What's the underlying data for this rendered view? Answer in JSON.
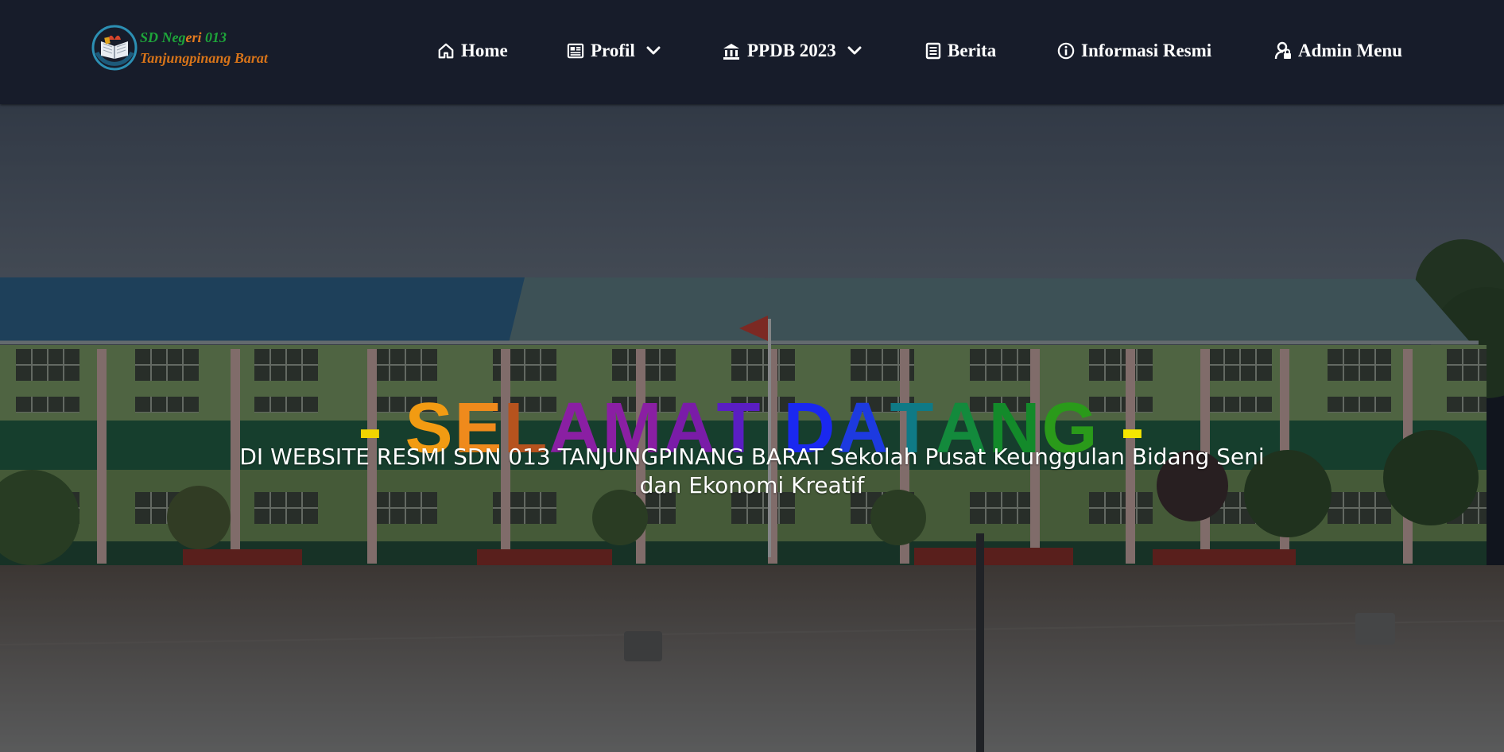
{
  "logo": {
    "line1_green_a": "SD Neg",
    "line1_orange": "eri",
    "line1_green_b": " 013",
    "line2": "Tanjungpinang Barat"
  },
  "nav": [
    {
      "label": "Home",
      "icon": "home-icon",
      "dropdown": false
    },
    {
      "label": "Profil",
      "icon": "newspaper-icon",
      "dropdown": true
    },
    {
      "label": "PPDB 2023",
      "icon": "bank-icon",
      "dropdown": true
    },
    {
      "label": "Berita",
      "icon": "document-icon",
      "dropdown": false
    },
    {
      "label": "Informasi Resmi",
      "icon": "info-circle-icon",
      "dropdown": false
    },
    {
      "label": "Admin Menu",
      "icon": "user-lock-icon",
      "dropdown": false
    }
  ],
  "hero": {
    "headline_chars": [
      {
        "c": "-",
        "color": "#f2d400"
      },
      {
        "c": " ",
        "color": "#ffffff"
      },
      {
        "c": "S",
        "color": "#f29b12"
      },
      {
        "c": "E",
        "color": "#ef8a1c"
      },
      {
        "c": "L",
        "color": "#b6531e"
      },
      {
        "c": "A",
        "color": "#8a1fa3"
      },
      {
        "c": "M",
        "color": "#8a1fa3"
      },
      {
        "c": "A",
        "color": "#7a1ca8"
      },
      {
        "c": "T",
        "color": "#5a1ec2"
      },
      {
        "c": " ",
        "color": "#ffffff"
      },
      {
        "c": "D",
        "color": "#1a28f0"
      },
      {
        "c": "A",
        "color": "#1d3ae0"
      },
      {
        "c": "T",
        "color": "#0f7a86"
      },
      {
        "c": "A",
        "color": "#138a3c"
      },
      {
        "c": "N",
        "color": "#138a2a"
      },
      {
        "c": "G",
        "color": "#2a9a1a"
      },
      {
        "c": " ",
        "color": "#ffffff"
      },
      {
        "c": "-",
        "color": "#f5e600"
      }
    ],
    "subtitle": "DI WEBSITE RESMI SDN 013 TANJUNGPINANG BARAT Sekolah Pusat Keunggulan Bidang Seni dan Ekonomi Kreatif"
  },
  "colors": {
    "navbar": "#171c2a",
    "nav_text": "#ffffff",
    "logo_green": "#1ea53a",
    "logo_orange": "#d87419"
  }
}
